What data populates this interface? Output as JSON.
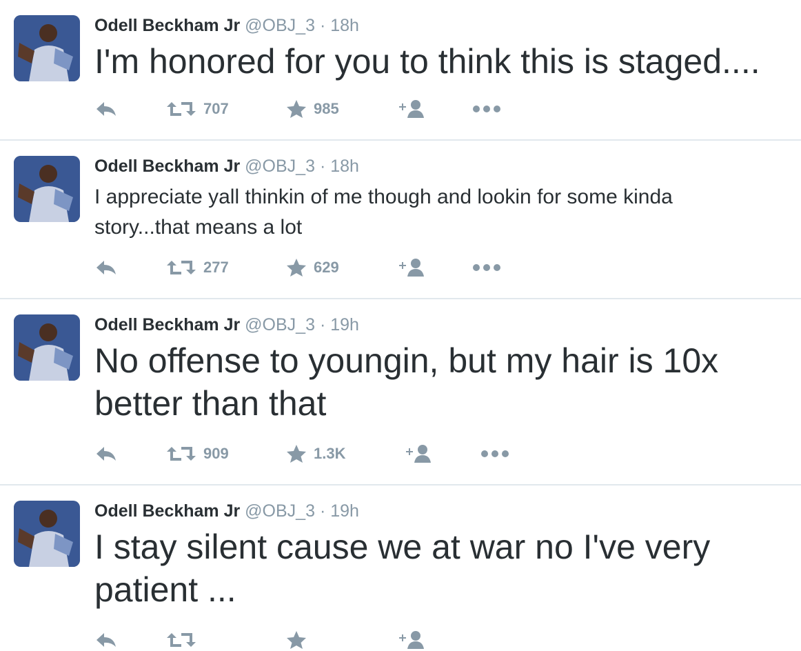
{
  "tweets": [
    {
      "name": "Odell Beckham Jr",
      "handle": "@OBJ_3",
      "time": "18h",
      "text": "I'm honored for you to think this is staged....",
      "retweets": "707",
      "favorites": "985",
      "size": "big"
    },
    {
      "name": "Odell Beckham Jr",
      "handle": "@OBJ_3",
      "time": "18h",
      "text": "I appreciate yall thinkin of me though and lookin for some kinda story...that means a lot",
      "retweets": "277",
      "favorites": "629",
      "size": "small"
    },
    {
      "name": "Odell Beckham Jr",
      "handle": "@OBJ_3",
      "time": "19h",
      "text": "No offense to youngin, but my hair is 10x better than that",
      "retweets": "909",
      "favorites": "1.3K",
      "size": "big"
    },
    {
      "name": "Odell Beckham Jr",
      "handle": "@OBJ_3",
      "time": "19h",
      "text": "I stay silent cause we at war no I've very patient ...",
      "retweets": "",
      "favorites": "",
      "size": "big"
    }
  ],
  "icons": {
    "reply": "reply-icon",
    "retweet": "retweet-icon",
    "favorite": "star-icon",
    "follow": "follow-icon",
    "more": "more-icon"
  },
  "colors": {
    "text": "#292f33",
    "muted": "#8899a6",
    "divider": "#e1e8ed"
  }
}
